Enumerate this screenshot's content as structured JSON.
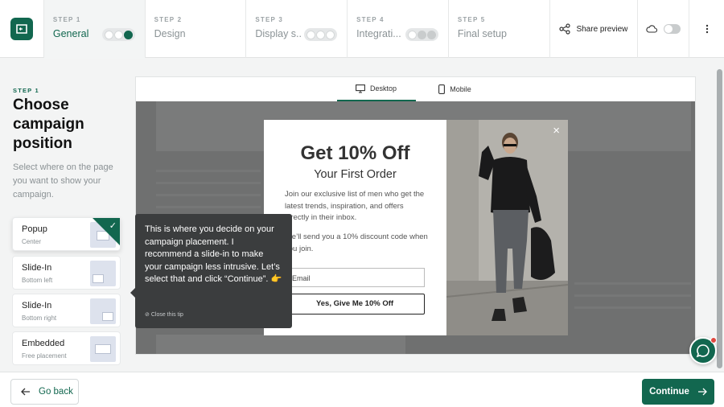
{
  "steps": [
    {
      "num": "STEP 1",
      "name": "General"
    },
    {
      "num": "STEP 2",
      "name": "Design"
    },
    {
      "num": "STEP 3",
      "name": "Display s..."
    },
    {
      "num": "STEP 4",
      "name": "Integrati..."
    },
    {
      "num": "STEP 5",
      "name": "Final setup"
    }
  ],
  "header": {
    "share_label": "Share preview"
  },
  "panel": {
    "step_label": "STEP 1",
    "title": "Choose campaign position",
    "description": "Select where on the page you want to show your campaign."
  },
  "options": [
    {
      "title": "Popup",
      "sub": "Center"
    },
    {
      "title": "Slide-In",
      "sub": "Bottom left"
    },
    {
      "title": "Slide-In",
      "sub": "Bottom right"
    },
    {
      "title": "Embedded",
      "sub": "Free placement"
    }
  ],
  "tooltip": {
    "text": "This is where you decide on your campaign placement. I recommend a slide-in to make your campaign less intrusive. Let’s select that and click “Continue”. 👉",
    "close": "Close this tip"
  },
  "preview": {
    "tabs": [
      "Desktop",
      "Mobile"
    ],
    "popup": {
      "headline": "Get 10% Off",
      "subheadline": "Your First Order",
      "paragraph1": "Join our exclusive list of men who get the latest trends, inspiration, and offers directly in their inbox.",
      "paragraph2": "We’ll send you a 10% discount code when you join.",
      "email_placeholder": "Email",
      "button": "Yes, Give Me 10% Off",
      "close": "×"
    }
  },
  "footer": {
    "back": "Go back",
    "continue": "Continue"
  },
  "colors": {
    "brand": "#12674f",
    "tooltip": "#3b3d3e",
    "stage": "#6f7070"
  }
}
